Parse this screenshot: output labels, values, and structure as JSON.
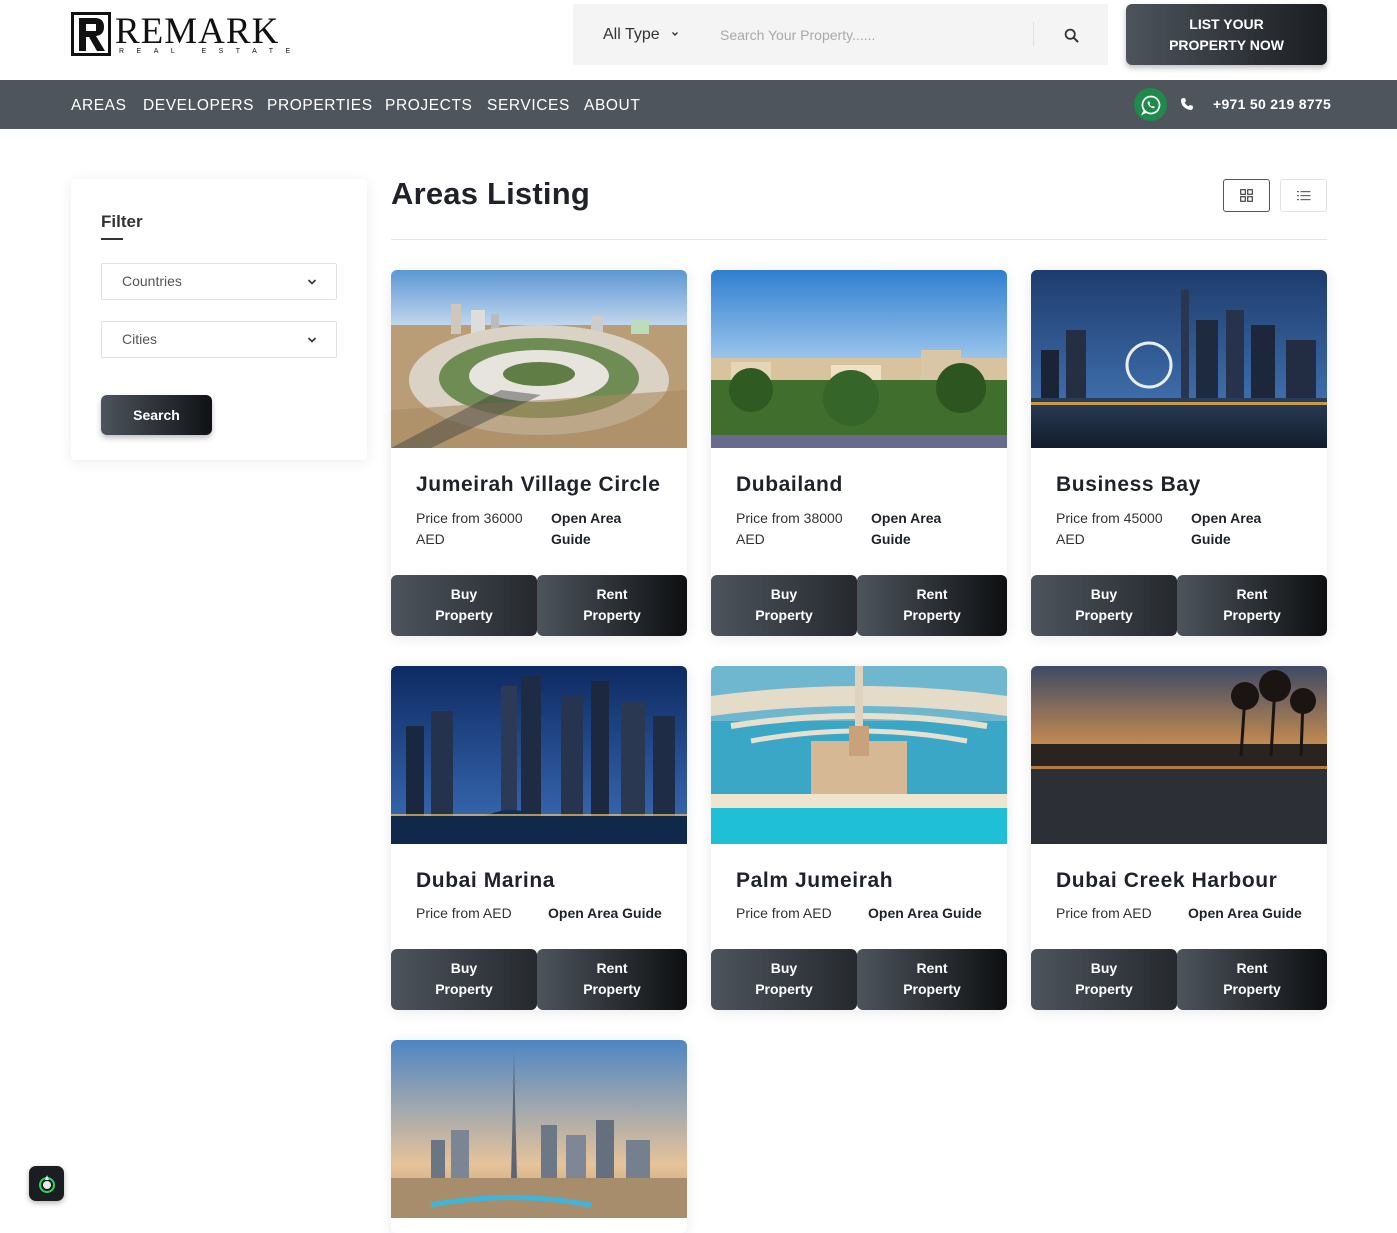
{
  "brand": {
    "name": "REMARK",
    "tagline": "REAL ESTATE"
  },
  "search": {
    "type_label": "All Type",
    "placeholder": "Search Your Property......"
  },
  "header": {
    "cta_line1": "LIST YOUR",
    "cta_line2": "PROPERTY NOW"
  },
  "nav": {
    "items": [
      "AREAS",
      "DEVELOPERS",
      "PROPERTIES",
      "PROJECTS",
      "SERVICES",
      "ABOUT"
    ],
    "phone": "+971 50 219 8775"
  },
  "filter": {
    "title": "Filter",
    "countries_label": "Countries",
    "cities_label": "Cities",
    "search_label": "Search"
  },
  "main": {
    "title": "Areas Listing"
  },
  "buttons": {
    "buy_line1": "Buy",
    "buy_line2": "Property",
    "rent_line1": "Rent",
    "rent_line2": "Property"
  },
  "areas": [
    {
      "name": "Jumeirah Village Circle",
      "price_line1": "Price from 36000",
      "price_line2": "AED",
      "guide_line1": "Open Area",
      "guide_line2": "Guide"
    },
    {
      "name": "Dubailand",
      "price_line1": "Price from 38000",
      "price_line2": "AED",
      "guide_line1": "Open Area",
      "guide_line2": "Guide"
    },
    {
      "name": "Business Bay",
      "price_line1": "Price from 45000",
      "price_line2": "AED",
      "guide_line1": "Open Area",
      "guide_line2": "Guide"
    },
    {
      "name": "Dubai Marina",
      "price": "Price from AED",
      "guide": "Open Area Guide"
    },
    {
      "name": "Palm Jumeirah",
      "price": "Price from AED",
      "guide": "Open Area Guide"
    },
    {
      "name": "Dubai Creek Harbour",
      "price": "Price from AED",
      "guide": "Open Area Guide"
    }
  ],
  "colors": {
    "nav_bg": "#4f555c",
    "whatsapp": "#1f8a4c",
    "text_dark": "#1f2329"
  },
  "icons": [
    "chevron-down-icon",
    "search-icon",
    "whatsapp-icon",
    "phone-icon",
    "grid-view-icon",
    "list-view-icon",
    "app-launcher-icon"
  ]
}
